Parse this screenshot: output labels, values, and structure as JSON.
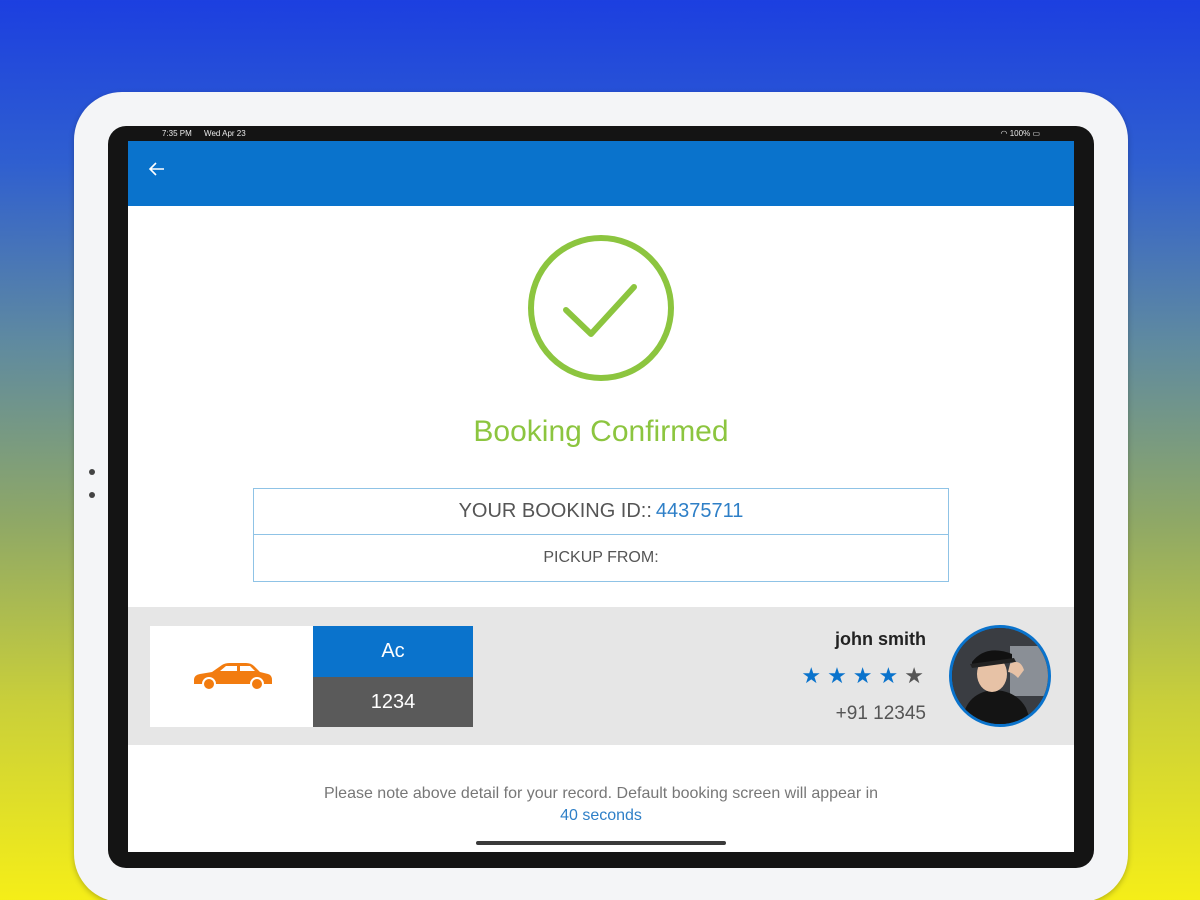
{
  "statusbar": {
    "time": "7:35 PM",
    "date": "Wed Apr 23",
    "battery": "100%"
  },
  "header": {
    "back_icon": "back-arrow-icon"
  },
  "confirmation": {
    "title": "Booking Confirmed",
    "icon": "check-circle-icon",
    "color": "#8cc53f"
  },
  "booking": {
    "id_label": "YOUR BOOKING ID::",
    "id_value": "44375711",
    "pickup_label": "PICKUP FROM:"
  },
  "vehicle": {
    "icon": "car-icon",
    "type": "Ac",
    "number": "1234"
  },
  "driver": {
    "name": "john smith",
    "rating": 4,
    "rating_max": 5,
    "phone": "+91 12345"
  },
  "note": {
    "text": "Please note above detail for your record. Default booking screen will appear in",
    "countdown": "40 seconds"
  },
  "colors": {
    "primary": "#0a73cc",
    "success": "#8cc53f",
    "link": "#2e7fc7"
  }
}
